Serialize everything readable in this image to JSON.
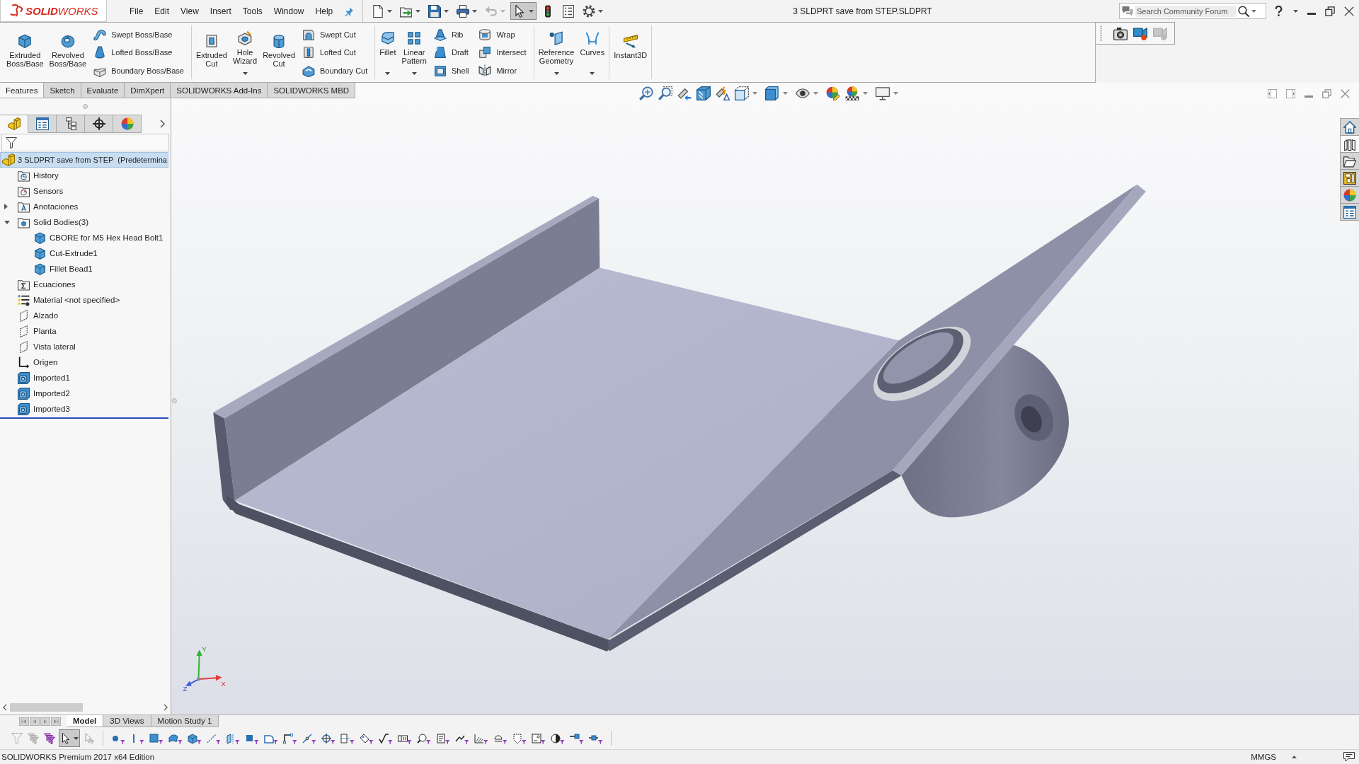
{
  "app": {
    "logo": "**SOLID**WORKS",
    "menu": [
      "File",
      "Edit",
      "View",
      "Insert",
      "Tools",
      "Window",
      "Help"
    ],
    "quick_access": [
      {
        "dropdown": true,
        "disabled": false,
        "pressed": false
      },
      {
        "dropdown": true,
        "disabled": false,
        "pressed": false
      },
      {
        "dropdown": true,
        "disabled": false,
        "pressed": false
      },
      {
        "dropdown": true,
        "disabled": false,
        "pressed": false
      },
      {
        "dropdown": true,
        "disabled": true,
        "pressed": false
      },
      {
        "dropdown": true,
        "disabled": false,
        "pressed": true
      },
      {
        "dropdown": false,
        "disabled": false,
        "pressed": false
      },
      {
        "dropdown": false,
        "disabled": false,
        "pressed": false
      },
      {
        "dropdown": true,
        "disabled": false,
        "pressed": false
      }
    ],
    "document_title": "3 SLDPRT save from STEP.SLDPRT",
    "search": {
      "placeholder": "Search Community Forum"
    }
  },
  "command_manager": {
    "groups": [
      {
        "tools": [
          {
            "kind": "large",
            "label": "Extruded Boss/Base",
            "dropdown": false
          },
          {
            "kind": "large",
            "label": "Revolved Boss/Base",
            "dropdown": false
          },
          {
            "kind": "stack",
            "items": [
              {
                "label": "Swept Boss/Base"
              },
              {
                "label": "Lofted Boss/Base"
              },
              {
                "label": "Boundary Boss/Base"
              }
            ]
          }
        ]
      },
      {
        "tools": [
          {
            "kind": "large",
            "label": "Extruded Cut",
            "dropdown": false
          },
          {
            "kind": "large",
            "label": "Hole Wizard",
            "dropdown": true
          },
          {
            "kind": "large",
            "label": "Revolved Cut",
            "dropdown": false
          },
          {
            "kind": "stack",
            "items": [
              {
                "label": "Swept Cut"
              },
              {
                "label": "Lofted Cut"
              },
              {
                "label": "Boundary Cut"
              }
            ]
          }
        ]
      },
      {
        "tools": [
          {
            "kind": "large",
            "label": "Fillet",
            "dropdown": true
          },
          {
            "kind": "large",
            "label": "Linear Pattern",
            "dropdown": true
          },
          {
            "kind": "stack",
            "items": [
              {
                "label": "Rib"
              },
              {
                "label": "Draft"
              },
              {
                "label": "Shell"
              }
            ]
          },
          {
            "kind": "stack",
            "items": [
              {
                "label": "Wrap"
              },
              {
                "label": "Intersect"
              },
              {
                "label": "Mirror"
              }
            ]
          }
        ]
      },
      {
        "tools": [
          {
            "kind": "large",
            "label": "Reference Geometry",
            "dropdown": true
          },
          {
            "kind": "large",
            "label": "Curves",
            "dropdown": true
          }
        ]
      },
      {
        "tools": [
          {
            "kind": "large",
            "label": "Instant3D",
            "dropdown": false
          }
        ]
      }
    ],
    "tabs": [
      {
        "label": "Features",
        "selected": true
      },
      {
        "label": "Sketch",
        "selected": false
      },
      {
        "label": "Evaluate",
        "selected": false
      },
      {
        "label": "DimXpert",
        "selected": false
      },
      {
        "label": "SOLIDWORKS Add-Ins",
        "selected": false
      },
      {
        "label": "SOLIDWORKS MBD",
        "selected": false
      }
    ]
  },
  "record_toolbar": [
    {
      "disabled": false
    },
    {
      "disabled": false
    },
    {
      "disabled": true
    }
  ],
  "feature_manager": {
    "panel_tabs": [
      {
        "selected": true
      },
      {
        "selected": false
      },
      {
        "selected": false
      },
      {
        "selected": false
      },
      {
        "selected": false
      }
    ],
    "root": {
      "label": "3 SLDPRT save from STEP  (Predetermina",
      "selected": true
    },
    "items": [
      {
        "kind": "history",
        "label": "History",
        "selected": false
      },
      {
        "kind": "sensors",
        "label": "Sensors",
        "selected": false
      },
      {
        "kind": "annotations",
        "label": "Anotaciones",
        "expanded": false,
        "selected": false
      },
      {
        "kind": "bodies",
        "label": "Solid Bodies(3)",
        "expanded": true,
        "selected": false,
        "children": [
          {
            "kind": "body",
            "label": "CBORE for M5 Hex Head Bolt1",
            "selected": false
          },
          {
            "kind": "body",
            "label": "Cut-Extrude1",
            "selected": false
          },
          {
            "kind": "body",
            "label": "Fillet Bead1",
            "selected": false
          }
        ]
      },
      {
        "kind": "equations",
        "label": "Ecuaciones",
        "selected": false
      },
      {
        "kind": "material",
        "label": "Material <not specified>",
        "selected": false
      },
      {
        "kind": "plane",
        "label": "Alzado",
        "selected": false
      },
      {
        "kind": "plane",
        "label": "Planta",
        "selected": false
      },
      {
        "kind": "plane",
        "label": "Vista lateral",
        "selected": false
      },
      {
        "kind": "origin",
        "label": "Origen",
        "selected": false
      },
      {
        "kind": "import",
        "label": "Imported1",
        "selected": false
      },
      {
        "kind": "import",
        "label": "Imported2",
        "selected": false
      },
      {
        "kind": "import",
        "label": "Imported3",
        "selected": false
      }
    ]
  },
  "graphics": {
    "heads_up": [
      {
        "dropdown": false
      },
      {
        "dropdown": false
      },
      {
        "dropdown": false
      },
      {
        "dropdown": false
      },
      {
        "dropdown": false
      },
      {
        "dropdown": true
      },
      {
        "dropdown": true
      },
      {
        "dropdown": true
      },
      {
        "dropdown": false
      },
      {
        "dropdown": true
      },
      {
        "dropdown": true
      }
    ],
    "triad": {
      "x": "X",
      "y": "Y",
      "z": "Z"
    },
    "task_pane": [
      {
        "selected": false
      },
      {
        "selected": true
      },
      {
        "selected": false
      },
      {
        "selected": false
      },
      {
        "selected": false
      },
      {
        "selected": false
      }
    ]
  },
  "bottom_tabs": [
    {
      "label": "Model",
      "selected": true
    },
    {
      "label": "3D Views",
      "selected": false
    },
    {
      "label": "Motion Study 1",
      "selected": false
    }
  ],
  "filter_toolbar": [
    {
      "dropdown": false,
      "disabled": true,
      "pressed": false
    },
    {
      "dropdown": false,
      "disabled": true,
      "pressed": false
    },
    {
      "dropdown": false,
      "disabled": false,
      "pressed": false
    },
    {
      "dropdown": true,
      "disabled": false,
      "pressed": true
    },
    {
      "dropdown": false,
      "disabled": true,
      "pressed": false
    },
    {
      "dropdown": false,
      "disabled": false,
      "pressed": false
    },
    {
      "dropdown": false,
      "disabled": false,
      "pressed": false
    },
    {
      "dropdown": false,
      "disabled": false,
      "pressed": false
    },
    {
      "dropdown": false,
      "disabled": false,
      "pressed": false
    },
    {
      "dropdown": false,
      "disabled": false,
      "pressed": false
    },
    {
      "dropdown": false,
      "disabled": false,
      "pressed": false
    },
    {
      "dropdown": false,
      "disabled": false,
      "pressed": false
    },
    {
      "dropdown": false,
      "disabled": false,
      "pressed": false
    },
    {
      "dropdown": false,
      "disabled": false,
      "pressed": false
    },
    {
      "dropdown": false,
      "disabled": false,
      "pressed": false
    },
    {
      "dropdown": false,
      "disabled": false,
      "pressed": false
    },
    {
      "dropdown": false,
      "disabled": false,
      "pressed": false
    },
    {
      "dropdown": false,
      "disabled": false,
      "pressed": false
    },
    {
      "dropdown": false,
      "disabled": false,
      "pressed": false
    },
    {
      "dropdown": false,
      "disabled": false,
      "pressed": false
    },
    {
      "dropdown": false,
      "disabled": false,
      "pressed": false
    },
    {
      "dropdown": false,
      "disabled": false,
      "pressed": false
    },
    {
      "dropdown": false,
      "disabled": false,
      "pressed": false
    },
    {
      "dropdown": false,
      "disabled": false,
      "pressed": false
    },
    {
      "dropdown": false,
      "disabled": false,
      "pressed": false
    },
    {
      "dropdown": false,
      "disabled": false,
      "pressed": false
    },
    {
      "dropdown": false,
      "disabled": false,
      "pressed": false
    },
    {
      "dropdown": false,
      "disabled": false,
      "pressed": false
    },
    {
      "dropdown": false,
      "disabled": false,
      "pressed": false
    },
    {
      "dropdown": false,
      "disabled": false,
      "pressed": false
    },
    {
      "dropdown": false,
      "disabled": false,
      "pressed": false
    }
  ],
  "status_bar": {
    "edition": "SOLIDWORKS Premium 2017 x64 Edition",
    "units": "MMGS"
  }
}
